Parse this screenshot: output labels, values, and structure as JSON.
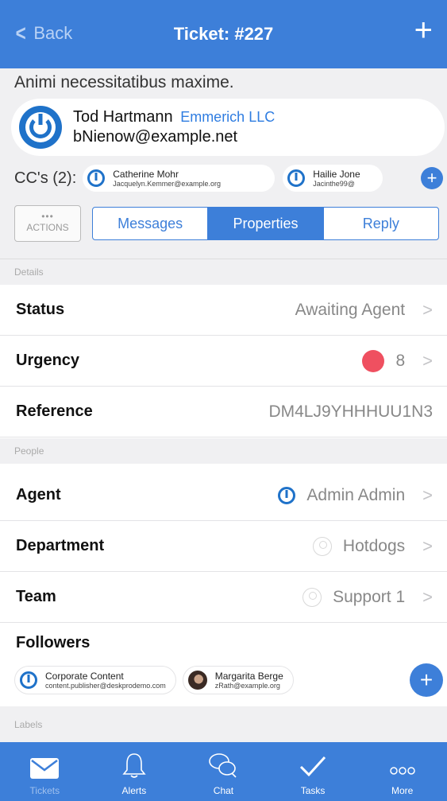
{
  "nav": {
    "back_label": "Back",
    "title": "Ticket: #227"
  },
  "ticket": {
    "subject": "Animi necessitatibus maxime.",
    "requester": {
      "name": "Tod Hartmann",
      "company": "Emmerich LLC",
      "email": "bNienow@example.net"
    }
  },
  "cc": {
    "label": "CC's (2):",
    "chips": [
      {
        "name": "Catherine Mohr",
        "email": "Jacquelyn.Kemmer@example.org"
      },
      {
        "name": "Hailie Jone",
        "email": "Jacinthe99@"
      }
    ]
  },
  "actions": {
    "dots": "•••",
    "label": "ACTIONS"
  },
  "segments": [
    {
      "label": "Messages"
    },
    {
      "label": "Properties"
    },
    {
      "label": "Reply"
    }
  ],
  "sections": {
    "details": "Details",
    "people": "People",
    "labels": "Labels"
  },
  "details": {
    "status": {
      "label": "Status",
      "value": "Awaiting Agent"
    },
    "urgency": {
      "label": "Urgency",
      "value": "8",
      "color": "#ef5060"
    },
    "reference": {
      "label": "Reference",
      "value": "DM4LJ9YHHHUU1N3"
    }
  },
  "people": {
    "agent": {
      "label": "Agent",
      "value": "Admin Admin"
    },
    "department": {
      "label": "Department",
      "value": "Hotdogs"
    },
    "team": {
      "label": "Team",
      "value": "Support 1"
    }
  },
  "followers": {
    "title": "Followers",
    "chips": [
      {
        "name": "Corporate Content",
        "email": "content.publisher@deskprodemo.com"
      },
      {
        "name": "Margarita Berge",
        "email": "zRath@example.org"
      }
    ]
  },
  "tabbar": [
    {
      "label": "Tickets",
      "icon": "envelope-icon"
    },
    {
      "label": "Alerts",
      "icon": "bell-icon"
    },
    {
      "label": "Chat",
      "icon": "chat-bubbles-icon"
    },
    {
      "label": "Tasks",
      "icon": "checkmark-icon"
    },
    {
      "label": "More",
      "icon": "more-dots-icon"
    }
  ],
  "colors": {
    "brand": "#3d7fd9",
    "logo": "#1f72c9"
  }
}
